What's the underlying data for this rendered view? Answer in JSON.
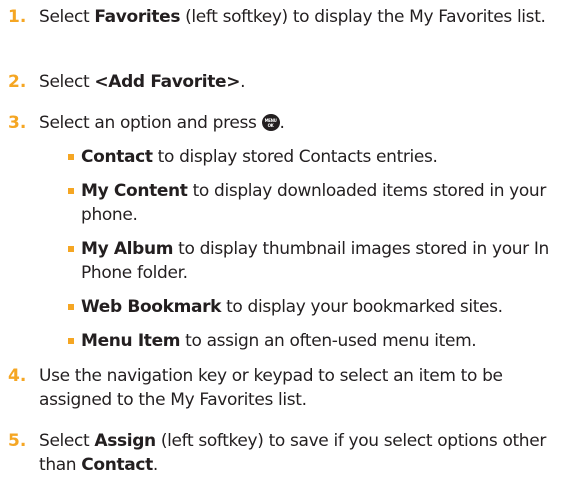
{
  "steps": [
    {
      "number": "1.",
      "parts": [
        {
          "text": "Select ",
          "bold": false
        },
        {
          "text": "Favorites",
          "bold": true
        },
        {
          "text": " (left softkey) to display the My Favorites list.",
          "bold": false
        }
      ]
    },
    {
      "number": "2.",
      "parts": [
        {
          "text": "Select ",
          "bold": false
        },
        {
          "text": "<Add Favorite>",
          "bold": true
        },
        {
          "text": ".",
          "bold": false
        }
      ]
    },
    {
      "number": "3.",
      "parts": [
        {
          "text": "Select an option and press ",
          "bold": false
        }
      ],
      "trailing_icon": {
        "name": "menu-ok-key-icon",
        "label_top": "MENU",
        "label_bottom": "OK"
      },
      "trailing_text": ".",
      "options": [
        {
          "term": "Contact",
          "desc": " to display stored Contacts entries."
        },
        {
          "term": "My Content",
          "desc": " to display downloaded items stored in your phone."
        },
        {
          "term": "My Album",
          "desc": " to display thumbnail images stored in your In Phone folder."
        },
        {
          "term": "Web Bookmark",
          "desc": " to display your bookmarked sites."
        },
        {
          "term": "Menu Item",
          "desc": " to assign an often-used menu item."
        }
      ]
    },
    {
      "number": "4.",
      "parts": [
        {
          "text": "Use the navigation key or keypad to select an item to be assigned to the My Favorites list.",
          "bold": false
        }
      ]
    },
    {
      "number": "5.",
      "parts": [
        {
          "text": "Select ",
          "bold": false
        },
        {
          "text": "Assign",
          "bold": true
        },
        {
          "text": " (left softkey) to save if you select options other than ",
          "bold": false
        },
        {
          "text": "Contact",
          "bold": true
        },
        {
          "text": ".",
          "bold": false
        }
      ]
    }
  ],
  "colors": {
    "accent": "#f5a623",
    "text": "#231f20"
  }
}
